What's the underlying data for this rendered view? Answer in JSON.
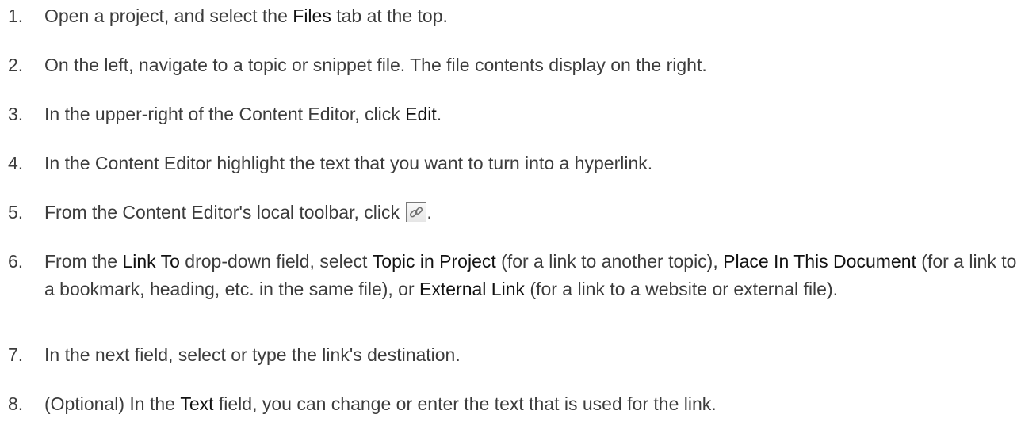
{
  "steps": [
    {
      "number": "1.",
      "t1": "Open a project, and select the ",
      "b1": "Files",
      "t2": " tab at the top."
    },
    {
      "number": "2.",
      "t1": "On the left, navigate to a topic or snippet file. The file contents display on the right."
    },
    {
      "number": "3.",
      "t1": "In the upper-right of the Content Editor, click ",
      "b1": "Edit",
      "t2": "."
    },
    {
      "number": "4.",
      "t1": "In the Content Editor highlight the text that you want to turn into a hyperlink."
    },
    {
      "number": "5.",
      "t1": "From the Content Editor's local toolbar, click ",
      "icon": "hyperlink-icon",
      "t2": "."
    },
    {
      "number": "6.",
      "t1": "From the ",
      "b1": "Link To",
      "t2": " drop-down field, select ",
      "b2": "Topic in Project",
      "t3": " (for a link to another topic), ",
      "b3": "Place In This Document",
      "t4": " (for a link to a bookmark, heading, etc. in the same file), or ",
      "b4": "External Link",
      "t5": " (for a link to a website or external file)."
    },
    {
      "number": "7.",
      "t1": "In the next field, select or type the link's destination."
    },
    {
      "number": "8.",
      "t1": "(Optional) In the ",
      "b1": "Text",
      "t2": " field, you can change or enter the text that is used for the link."
    }
  ],
  "colors": {
    "text": "#3c3c3c",
    "ui_term": "#111111",
    "background": "#ffffff"
  }
}
